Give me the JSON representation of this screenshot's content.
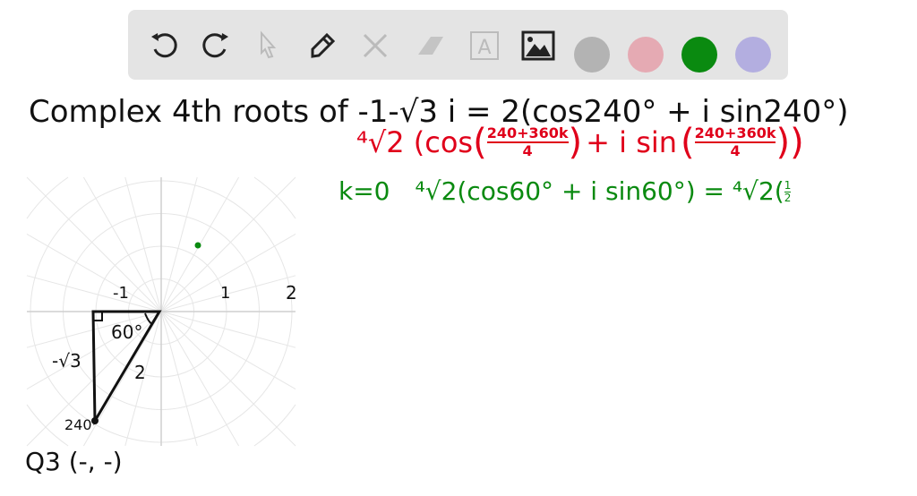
{
  "toolbar": {
    "tools": [
      "undo-icon",
      "redo-icon",
      "pointer-icon",
      "pen-icon",
      "tools-icon",
      "eraser-icon",
      "text-icon",
      "image-icon"
    ],
    "colors": [
      "#b3b3b3",
      "#e5aab3",
      "#0a8a10",
      "#b3aee0"
    ]
  },
  "board": {
    "title": "Complex 4th roots of -1-√3 i = 2(cos240° + i sin240°)",
    "formula_prefix": "⁴√2 (cos",
    "frac1_num": "240+360k",
    "frac1_den": "4",
    "formula_mid": "+ i sin",
    "frac2_num": "240+360k",
    "frac2_den": "4",
    "k0_label": "k=0",
    "k0_expr": "⁴√2(cos60° + i sin60°) = ⁴√2(",
    "k0_frac_num": "1",
    "k0_frac_den": "2",
    "graph": {
      "tick_neg1": "-1",
      "tick_1": "1",
      "tick_2": "2",
      "angle": "60°",
      "side": "-√3",
      "hyp": "2",
      "angle240": "240°",
      "quadrant": "Q3 (-, -)"
    }
  }
}
